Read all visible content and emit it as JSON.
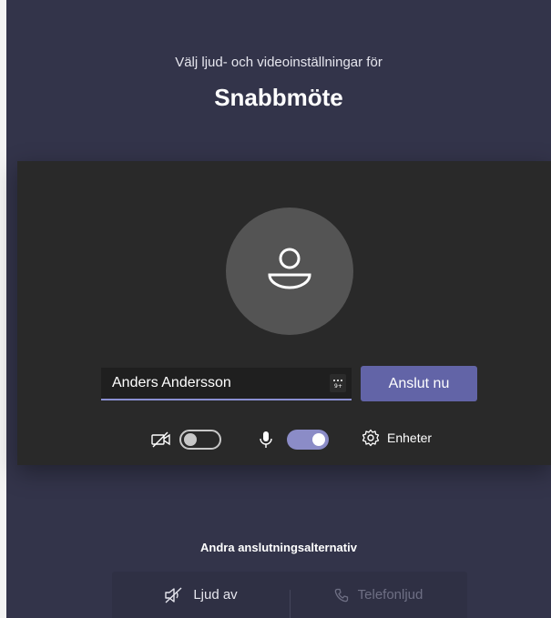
{
  "header": {
    "subtitle": "Välj ljud- och videoinställningar för",
    "meeting_title": "Snabbmöte"
  },
  "prejoin": {
    "name_input": {
      "value": "Anders Andersson",
      "placeholder": ""
    },
    "emoji_button_icon": "emoji-icon",
    "join_button_label": "Anslut nu",
    "camera": {
      "icon": "camera-off-icon",
      "enabled": false
    },
    "microphone": {
      "icon": "microphone-icon",
      "enabled": true
    },
    "devices": {
      "icon": "gear-icon",
      "label": "Enheter"
    }
  },
  "other_options": {
    "title": "Andra anslutningsalternativ",
    "items": [
      {
        "icon": "speaker-off-icon",
        "label": "Ljud av"
      },
      {
        "icon": "phone-icon",
        "label": "Telefonljud"
      }
    ]
  },
  "colors": {
    "background": "#33344a",
    "preview": "#292929",
    "accent": "#6264a7",
    "toggle_on": "#8b8cc7"
  }
}
